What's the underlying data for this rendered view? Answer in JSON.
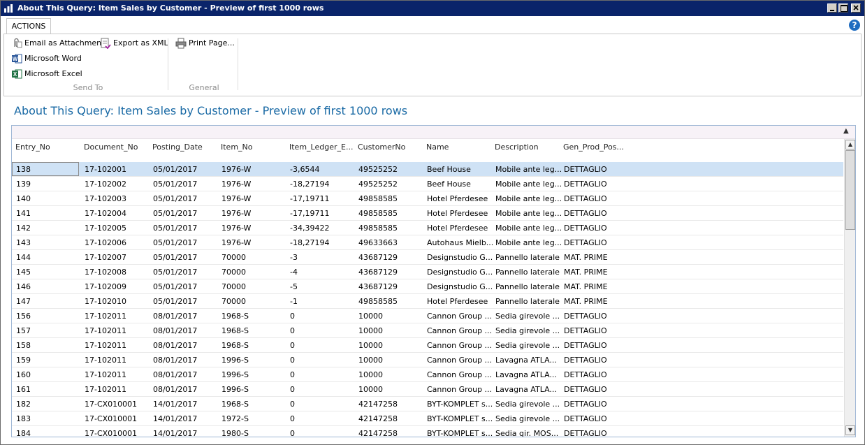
{
  "window": {
    "title": "About This Query: Item Sales by Customer - Preview of first 1000 rows",
    "titlebar_color": "#0a246a"
  },
  "ribbon": {
    "tab_label": "ACTIONS",
    "send_to": {
      "email_attachment": "Email as Attachment",
      "export_xml": "Export as XML",
      "microsoft_word": "Microsoft Word",
      "microsoft_excel": "Microsoft Excel",
      "group_label": "Send To"
    },
    "general": {
      "print_page": "Print Page...",
      "group_label": "General"
    },
    "icons": [
      "paperclip-icon",
      "export-xml-icon",
      "word-icon",
      "excel-icon",
      "printer-icon",
      "help-icon"
    ]
  },
  "page_title": "About This Query: Item Sales by Customer - Preview of first 1000 rows",
  "accent_color": "#1a6aa5",
  "selected_row_color": "#cfe2f5",
  "table": {
    "columns": [
      "Entry_No",
      "Document_No",
      "Posting_Date",
      "Item_No",
      "Item_Ledger_E...",
      "CustomerNo",
      "Name",
      "Description",
      "Gen_Prod_Pos..."
    ],
    "rows": [
      [
        "138",
        "17-102001",
        "05/01/2017",
        "1976-W",
        "-3,6544",
        "49525252",
        "Beef House",
        "Mobile ante leg...",
        "DETTAGLIO"
      ],
      [
        "139",
        "17-102002",
        "05/01/2017",
        "1976-W",
        "-18,27194",
        "49525252",
        "Beef House",
        "Mobile ante leg...",
        "DETTAGLIO"
      ],
      [
        "140",
        "17-102003",
        "05/01/2017",
        "1976-W",
        "-17,19711",
        "49858585",
        "Hotel Pferdesee",
        "Mobile ante leg...",
        "DETTAGLIO"
      ],
      [
        "141",
        "17-102004",
        "05/01/2017",
        "1976-W",
        "-17,19711",
        "49858585",
        "Hotel Pferdesee",
        "Mobile ante leg...",
        "DETTAGLIO"
      ],
      [
        "142",
        "17-102005",
        "05/01/2017",
        "1976-W",
        "-34,39422",
        "49858585",
        "Hotel Pferdesee",
        "Mobile ante leg...",
        "DETTAGLIO"
      ],
      [
        "143",
        "17-102006",
        "05/01/2017",
        "1976-W",
        "-18,27194",
        "49633663",
        "Autohaus Mielb...",
        "Mobile ante leg...",
        "DETTAGLIO"
      ],
      [
        "144",
        "17-102007",
        "05/01/2017",
        "70000",
        "-3",
        "43687129",
        "Designstudio G...",
        "Pannello laterale",
        "MAT. PRIME"
      ],
      [
        "145",
        "17-102008",
        "05/01/2017",
        "70000",
        "-4",
        "43687129",
        "Designstudio G...",
        "Pannello laterale",
        "MAT. PRIME"
      ],
      [
        "146",
        "17-102009",
        "05/01/2017",
        "70000",
        "-5",
        "43687129",
        "Designstudio G...",
        "Pannello laterale",
        "MAT. PRIME"
      ],
      [
        "147",
        "17-102010",
        "05/01/2017",
        "70000",
        "-1",
        "49858585",
        "Hotel Pferdesee",
        "Pannello laterale",
        "MAT. PRIME"
      ],
      [
        "156",
        "17-102011",
        "08/01/2017",
        "1968-S",
        "0",
        "10000",
        "Cannon Group ...",
        "Sedia girevole ...",
        "DETTAGLIO"
      ],
      [
        "157",
        "17-102011",
        "08/01/2017",
        "1968-S",
        "0",
        "10000",
        "Cannon Group ...",
        "Sedia girevole ...",
        "DETTAGLIO"
      ],
      [
        "158",
        "17-102011",
        "08/01/2017",
        "1968-S",
        "0",
        "10000",
        "Cannon Group ...",
        "Sedia girevole ...",
        "DETTAGLIO"
      ],
      [
        "159",
        "17-102011",
        "08/01/2017",
        "1996-S",
        "0",
        "10000",
        "Cannon Group ...",
        "Lavagna ATLA...",
        "DETTAGLIO"
      ],
      [
        "160",
        "17-102011",
        "08/01/2017",
        "1996-S",
        "0",
        "10000",
        "Cannon Group ...",
        "Lavagna ATLA...",
        "DETTAGLIO"
      ],
      [
        "161",
        "17-102011",
        "08/01/2017",
        "1996-S",
        "0",
        "10000",
        "Cannon Group ...",
        "Lavagna ATLA...",
        "DETTAGLIO"
      ],
      [
        "182",
        "17-CX010001",
        "14/01/2017",
        "1968-S",
        "0",
        "42147258",
        "BYT-KOMPLET s...",
        "Sedia girevole ...",
        "DETTAGLIO"
      ],
      [
        "183",
        "17-CX010001",
        "14/01/2017",
        "1972-S",
        "0",
        "42147258",
        "BYT-KOMPLET s...",
        "Sedia girevole ...",
        "DETTAGLIO"
      ],
      [
        "184",
        "17-CX010001",
        "14/01/2017",
        "1980-S",
        "0",
        "42147258",
        "BYT-KOMPLET s...",
        "Sedia gir. MOS...",
        "DETTAGLIO"
      ]
    ],
    "selected_row": 0
  }
}
